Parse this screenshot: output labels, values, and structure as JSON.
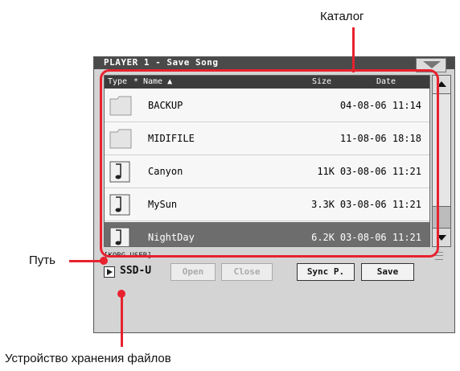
{
  "callouts": {
    "catalog": "Каталог",
    "path": "Путь",
    "storage": "Устройство хранения файлов"
  },
  "window": {
    "title": "PLAYER 1 - Save Song"
  },
  "columns": {
    "type": "Type",
    "star": "*",
    "name": "Name",
    "size": "Size",
    "date": "Date"
  },
  "files": [
    {
      "name": "BACKUP",
      "size": "",
      "date": "04-08-06 11:14",
      "kind": "folder",
      "selected": false
    },
    {
      "name": "MIDIFILE",
      "size": "",
      "date": "11-08-06 18:18",
      "kind": "folder",
      "selected": false
    },
    {
      "name": "Canyon",
      "size": "11K",
      "date": "03-08-06 11:21",
      "kind": "song",
      "selected": false
    },
    {
      "name": "MySun",
      "size": "3.3K",
      "date": "03-08-06 11:21",
      "kind": "song",
      "selected": false
    },
    {
      "name": "NightDay",
      "size": "6.2K",
      "date": "03-08-06 11:21",
      "kind": "song",
      "selected": true
    }
  ],
  "path": "[KORG USER]",
  "device": "SSD-U",
  "buttons": {
    "open": "Open",
    "close": "Close",
    "sync": "Sync P.",
    "save": "Save"
  },
  "colors": {
    "highlight": "#e8212e",
    "selected_row": "#6d6d6d",
    "header": "#3c3c3c"
  }
}
